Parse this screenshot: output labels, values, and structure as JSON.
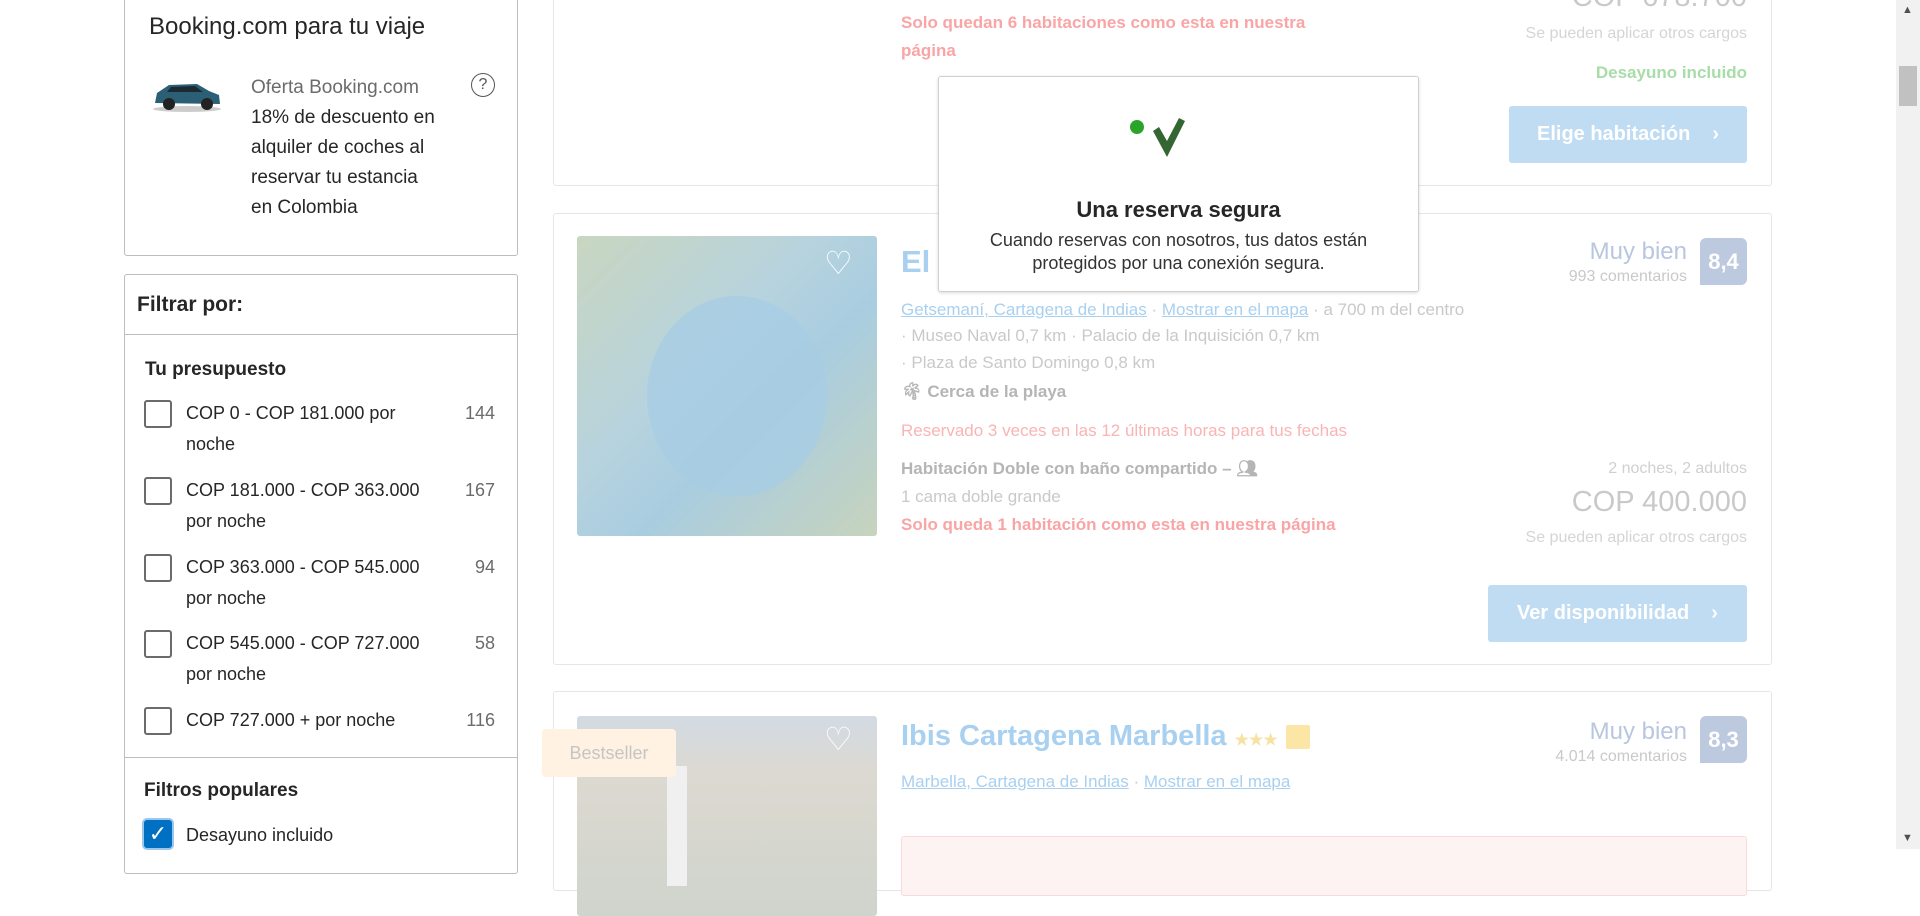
{
  "sidebar": {
    "offers_title_line1": "Ofertas exclusivas de",
    "offers_title_line2": "Booking.com para tu viaje",
    "offer_label": "Oferta Booking.com",
    "offer_text": [
      "18% de descuento en",
      "alquiler de coches al",
      "reservar tu estancia",
      "en Colombia"
    ],
    "filter_title": "Filtrar por:",
    "budget_title": "Tu presupuesto",
    "budget": [
      {
        "line1": "COP 0 - COP 181.000 por",
        "line2": "noche",
        "count": "144"
      },
      {
        "line1": "COP 181.000 - COP 363.000",
        "line2": "por noche",
        "count": "167"
      },
      {
        "line1": "COP 363.000 - COP 545.000",
        "line2": "por noche",
        "count": "94"
      },
      {
        "line1": "COP 545.000 - COP 727.000",
        "line2": "por noche",
        "count": "58"
      },
      {
        "line1": "COP 727.000 + por noche",
        "line2": "",
        "count": "116"
      }
    ],
    "popular_title": "Filtros populares",
    "popular": [
      {
        "label": "Desayuno incluido",
        "checked": true
      }
    ]
  },
  "cards": [
    {
      "availability": [
        "Solo quedan 6 habitaciones como esta en nuestra",
        "página"
      ],
      "price": "COP 678.700",
      "charges": "Se pueden aplicar otros cargos",
      "breakfast": "Desayuno incluido",
      "button": "Elige habitación"
    },
    {
      "title": "El A",
      "location": "Getsemaní, Cartagena de Indias",
      "map": "Mostrar en el mapa",
      "distance": "a 700 m del centro",
      "landmarks": [
        "Museo Naval 0,7 km",
        "Palacio de la Inquisición 0,7 km",
        "Plaza de Santo Domingo 0,8 km"
      ],
      "beach": "Cerca de la playa",
      "booked": "Reservado 3 veces en las 12 últimas horas para tus fechas",
      "room": "Habitación Doble con baño compartido",
      "dash": "–",
      "bed": "1 cama doble grande",
      "availability": "Solo queda 1 habitación como esta en nuestra página",
      "rating_word": "Muy bien",
      "reviews": "993 comentarios",
      "score": "8,4",
      "stay": "2 noches, 2 adultos",
      "price": "COP 400.000",
      "charges": "Se pueden aplicar otros cargos",
      "button": "Ver disponibilidad"
    },
    {
      "badge": "Bestseller",
      "title": "Ibis Cartagena Marbella",
      "stars": "★★★",
      "location": "Marbella, Cartagena de Indias",
      "map": "Mostrar en el mapa",
      "rating_word": "Muy bien",
      "reviews": "4.014 comentarios",
      "score": "8,3"
    }
  ],
  "modal": {
    "title": "Una reserva segura",
    "text_line1": "Cuando reservas con nosotros, tus datos están",
    "text_line2": "protegidos por una conexión segura."
  },
  "colors": {
    "accent": "#0071c2",
    "green": "#2aa52a",
    "check": "#336633"
  }
}
